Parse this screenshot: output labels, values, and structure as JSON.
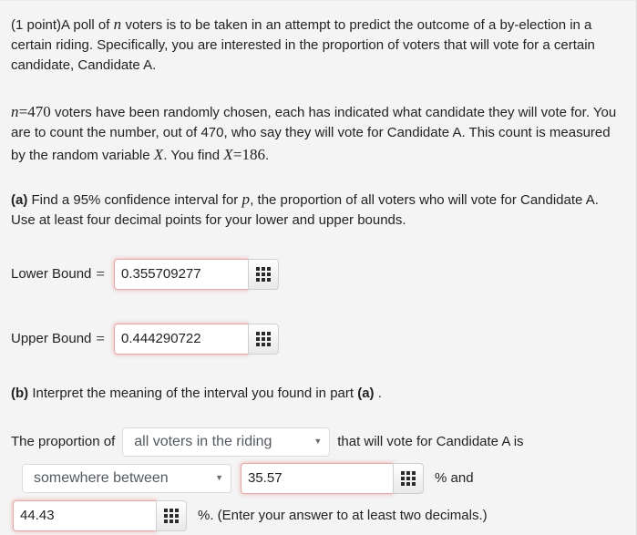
{
  "problem": {
    "point_label": "(1 point)",
    "intro_part1": "A poll of ",
    "intro_var_n": "n",
    "intro_part2": " voters is to be taken in an attempt to predict the outcome of a by-election in a certain riding. Specifically, you are interested in the proportion of voters that will vote for a certain candidate, Candidate A.",
    "para2_var_n": "n",
    "para2_eq": "=",
    "para2_n_value": "470",
    "para2_part1": " voters have been randomly chosen, each has indicated what candidate they will vote for. You are to count the number, out of 470, who say they will vote for Candidate A. This count is measured by the random variable ",
    "para2_var_X": "X",
    "para2_part2": ". You find ",
    "para2_var_X2": "X",
    "para2_eq2": "=",
    "para2_X_value": "186",
    "para2_period": "."
  },
  "part_a": {
    "marker": "(a)",
    "text_before_p": " Find a 95% confidence interval for ",
    "var_p": "p",
    "text_after_p": ", the proportion of all voters who will vote for Candidate A. Use at least four decimal points for your lower and upper bounds.",
    "lower_label": "Lower Bound",
    "lower_eq": "=",
    "lower_value": "0.355709277",
    "upper_label": "Upper Bound",
    "upper_eq": "=",
    "upper_value": "0.444290722"
  },
  "part_b": {
    "marker": "(b)",
    "text": " Interpret the meaning of the interval you found in part ",
    "marker_ref": "(a)",
    "text_end": " .",
    "sentence_start": "The proportion of",
    "select_population_value": "all voters in the riding",
    "sentence_middle": "that will vote for Candidate A is",
    "select_relation_value": "somewhere between",
    "percent_low_value": "35.57",
    "percent_and": "% and",
    "percent_high_value": "44.43",
    "tail_text": "%. (Enter your answer to at least two decimals.)"
  },
  "icons": {
    "grid": "grid-icon",
    "caret": "▼"
  },
  "colors": {
    "page_bg": "#f4f4f4",
    "input_border_error": "#e8a9a6",
    "text": "#222222",
    "select_text": "#54595f"
  }
}
